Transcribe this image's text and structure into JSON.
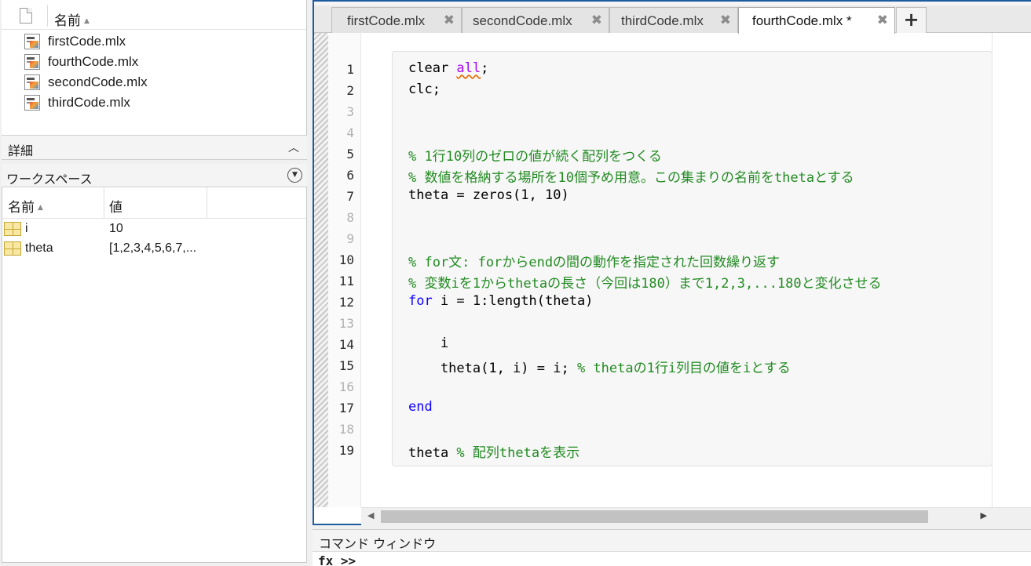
{
  "current_folder": {
    "column_header": "名前",
    "files": [
      "firstCode.mlx",
      "fourthCode.mlx",
      "secondCode.mlx",
      "thirdCode.mlx"
    ]
  },
  "details": {
    "title": "詳細"
  },
  "workspace": {
    "title": "ワークスペース",
    "columns": [
      "名前",
      "値"
    ],
    "variables": [
      {
        "name": "i",
        "value": "10"
      },
      {
        "name": "theta",
        "value": "[1,2,3,4,5,6,7,..."
      }
    ]
  },
  "editor": {
    "tabs": [
      "firstCode.mlx",
      "secondCode.mlx",
      "thirdCode.mlx",
      "fourthCode.mlx *"
    ],
    "active_tab": 3,
    "line_numbers": [
      "1",
      "2",
      "3",
      "4",
      "5",
      "6",
      "7",
      "8",
      "9",
      "10",
      "11",
      "12",
      "13",
      "14",
      "15",
      "16",
      "17",
      "18",
      "19"
    ],
    "code": {
      "l1_a": "clear ",
      "l1_b": "all",
      "l1_c": ";",
      "l2": "clc;",
      "l5": "% 1行10列のゼロの値が続く配列をつくる",
      "l6": "% 数値を格納する場所を10個予め用意。この集まりの名前をthetaとする",
      "l7": "theta = zeros(1, 10)",
      "l10": "% for文: forからendの間の動作を指定された回数繰り返す",
      "l11": "% 変数iを1からthetaの長さ（今回は180）まで1,2,3,...180と変化させる",
      "l12_kw": "for",
      "l12_rest": " i = 1:length(theta)",
      "l14": "    i",
      "l15_code": "    theta(1, i) = i; ",
      "l15_cm": "% thetaの1行i列目の値をiとする",
      "l17": "end",
      "l19_code": "theta ",
      "l19_cm": "% 配列thetaを表示"
    }
  },
  "command_window": {
    "title": "コマンド ウィンドウ",
    "prompt": "fx >>"
  },
  "colors": {
    "keyword": "#0e00ff",
    "comment": "#228b22",
    "string": "#a709f5",
    "accent": "#1d5b9e"
  }
}
